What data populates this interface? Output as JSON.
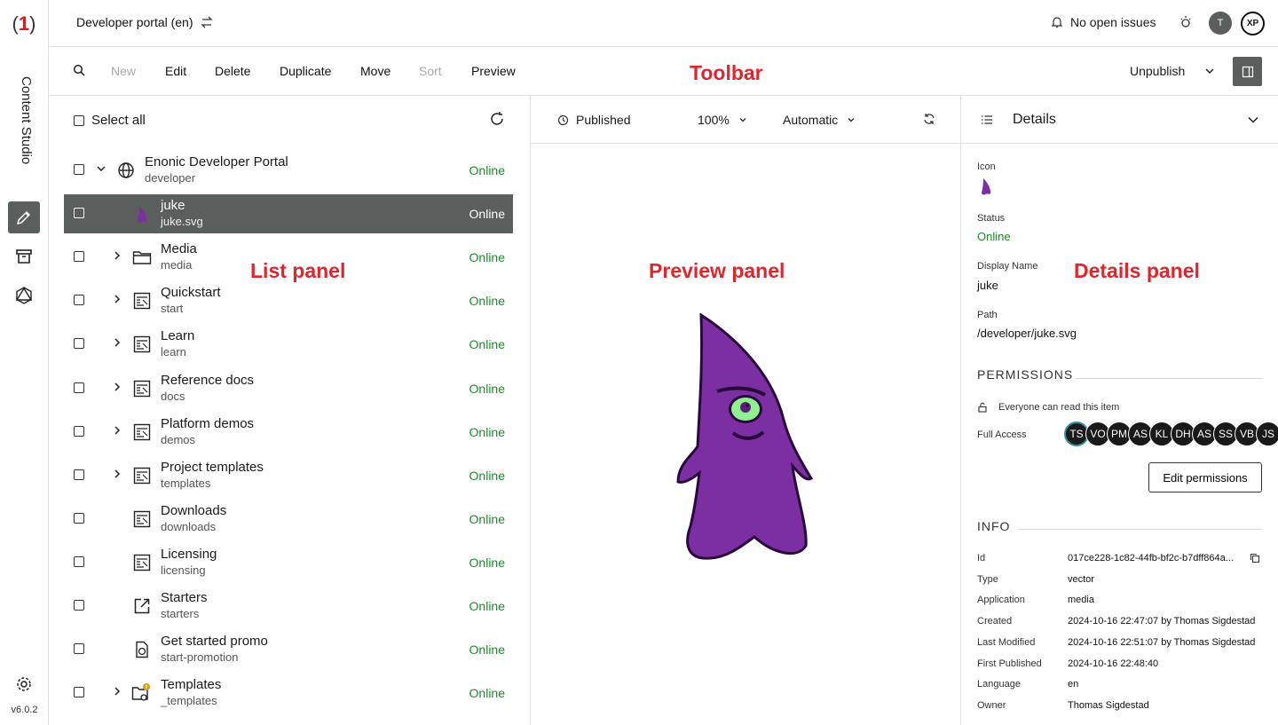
{
  "rail": {
    "logo_paren_open": "(",
    "logo_number": "1",
    "logo_paren_close": ")",
    "title": "Content Studio",
    "version": "v6.0.2"
  },
  "header": {
    "project": "Developer portal (en)",
    "issues": "No open issues",
    "avatar_initial": "T",
    "xp_label": "XP"
  },
  "toolbar": {
    "new_label": "New",
    "edit_label": "Edit",
    "delete_label": "Delete",
    "duplicate_label": "Duplicate",
    "move_label": "Move",
    "sort_label": "Sort",
    "preview_label": "Preview",
    "unpublish_label": "Unpublish"
  },
  "annotations": {
    "toolbar": "Toolbar",
    "list": "List panel",
    "preview": "Preview panel",
    "details": "Details panel"
  },
  "list": {
    "select_all": "Select all",
    "items": [
      {
        "name": "Enonic Developer Portal",
        "path": "developer",
        "status": "Online",
        "icon": "globe-icon",
        "expandable": true,
        "expanded": true
      },
      {
        "name": "juke",
        "path": "juke.svg",
        "status": "Online",
        "icon": "juke-icon",
        "expandable": false,
        "selected": true
      },
      {
        "name": "Media",
        "path": "media",
        "status": "Online",
        "icon": "folder-icon",
        "expandable": true
      },
      {
        "name": "Quickstart",
        "path": "start",
        "status": "Online",
        "icon": "page-icon",
        "expandable": true
      },
      {
        "name": "Learn",
        "path": "learn",
        "status": "Online",
        "icon": "page-icon",
        "expandable": true
      },
      {
        "name": "Reference docs",
        "path": "docs",
        "status": "Online",
        "icon": "page-icon",
        "expandable": true
      },
      {
        "name": "Platform demos",
        "path": "demos",
        "status": "Online",
        "icon": "page-icon",
        "expandable": true
      },
      {
        "name": "Project templates",
        "path": "templates",
        "status": "Online",
        "icon": "page-icon",
        "expandable": true
      },
      {
        "name": "Downloads",
        "path": "downloads",
        "status": "Online",
        "icon": "page-icon",
        "expandable": false
      },
      {
        "name": "Licensing",
        "path": "licensing",
        "status": "Online",
        "icon": "page-icon",
        "expandable": false
      },
      {
        "name": "Starters",
        "path": "starters",
        "status": "Online",
        "icon": "external-link-icon",
        "expandable": false
      },
      {
        "name": "Get started promo",
        "path": "start-promotion",
        "status": "Online",
        "icon": "fragment-icon",
        "expandable": false
      },
      {
        "name": "Templates",
        "path": "_templates",
        "status": "Online",
        "icon": "templates-folder-icon",
        "expandable": true
      }
    ]
  },
  "preview": {
    "published": "Published",
    "zoom": "100%",
    "mode": "Automatic"
  },
  "details": {
    "title": "Details",
    "icon_label": "Icon",
    "status_label": "Status",
    "status_value": "Online",
    "display_name_label": "Display Name",
    "display_name_value": "juke",
    "path_label": "Path",
    "path_value": "/developer/juke.svg",
    "permissions_header": "PERMISSIONS",
    "everyone_text": "Everyone can read this item",
    "full_access_label": "Full Access",
    "principals": [
      "TS",
      "VO",
      "PM",
      "AS",
      "KL",
      "DH",
      "AS",
      "SS",
      "VB",
      "JS"
    ],
    "edit_permissions": "Edit permissions",
    "info_header": "INFO",
    "info": [
      {
        "key": "Id",
        "value": "017ce228-1c82-44fb-bf2c-b7dff864a..."
      },
      {
        "key": "Type",
        "value": "vector"
      },
      {
        "key": "Application",
        "value": "media"
      },
      {
        "key": "Created",
        "value": "2024-10-16 22:47:07 by Thomas Sigdestad"
      },
      {
        "key": "Last Modified",
        "value": "2024-10-16 22:51:07 by Thomas Sigdestad"
      },
      {
        "key": "First Published",
        "value": "2024-10-16 22:48:40"
      },
      {
        "key": "Language",
        "value": "en"
      },
      {
        "key": "Owner",
        "value": "Thomas Sigdestad"
      }
    ]
  },
  "colors": {
    "online": "#1f8a2a",
    "selected_row": "#5a5e5d",
    "annotation": "#e0262c",
    "juke_purple": "#7b2fa3"
  }
}
